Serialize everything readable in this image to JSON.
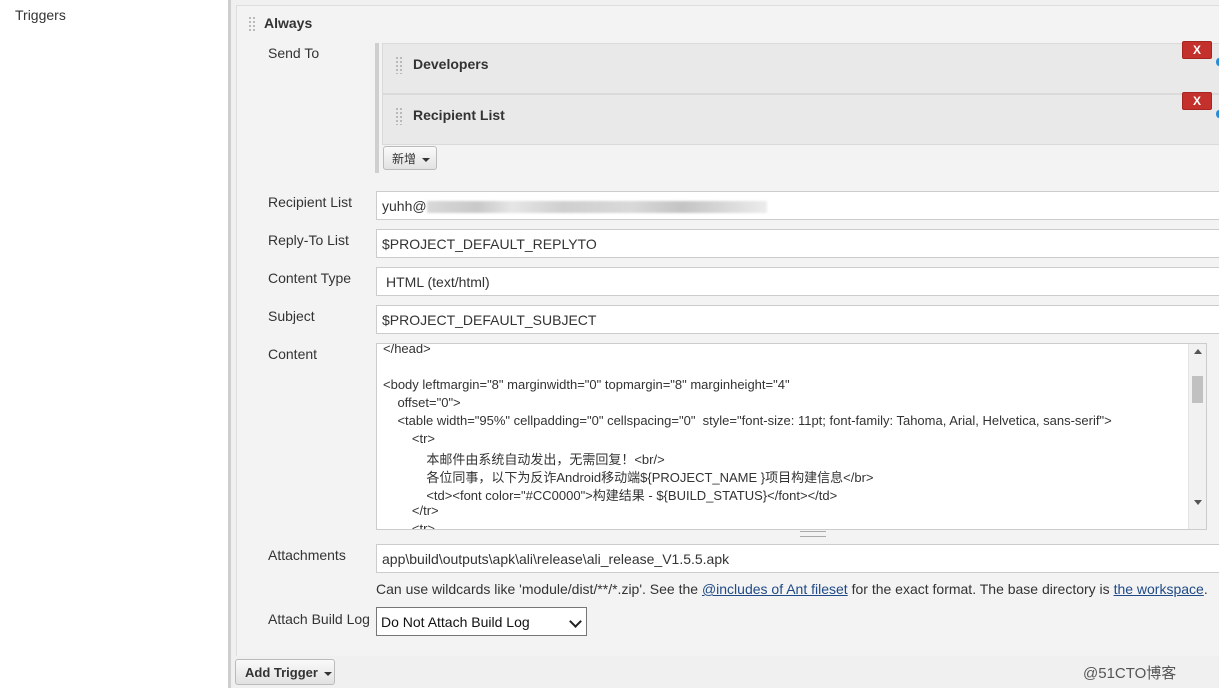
{
  "sidebar": {
    "triggers_label": "Triggers"
  },
  "section": {
    "title": "Always"
  },
  "send_to": {
    "label": "Send To",
    "items": [
      {
        "name": "Developers",
        "remove": "X"
      },
      {
        "name": "Recipient List",
        "remove": "X"
      }
    ],
    "add_button": "新增"
  },
  "fields": {
    "recipient_list": {
      "label": "Recipient List",
      "value_prefix": "yuhh@"
    },
    "reply_to": {
      "label": "Reply-To List",
      "value": "$PROJECT_DEFAULT_REPLYTO"
    },
    "content_type": {
      "label": "Content Type",
      "value": "HTML (text/html)"
    },
    "subject": {
      "label": "Subject",
      "value": "$PROJECT_DEFAULT_SUBJECT"
    },
    "content": {
      "label": "Content",
      "lines": [
        "</head>",
        "",
        "<body leftmargin=\"8\" marginwidth=\"0\" topmargin=\"8\" marginheight=\"4\"",
        "    offset=\"0\">",
        "    <table width=\"95%\" cellpadding=\"0\" cellspacing=\"0\"  style=\"font-size: 11pt; font-family: Tahoma, Arial, Helvetica, sans-serif\">",
        "        <tr>",
        "            本邮件由系统自动发出，无需回复！<br/>",
        "            各位同事，以下为反诈Android移动端${PROJECT_NAME }项目构建信息</br>",
        "            <td><font color=\"#CC0000\">构建结果 - ${BUILD_STATUS}</font></td>",
        "        </tr>",
        "        <tr>"
      ]
    },
    "attachments": {
      "label": "Attachments",
      "value": "app\\build\\outputs\\apk\\ali\\release\\ali_release_V1.5.5.apk"
    },
    "attach_build_log": {
      "label": "Attach Build Log",
      "selected": "Do Not Attach Build Log"
    }
  },
  "help": {
    "text1": "Can use wildcards like 'module/dist/**/*.zip'. See the ",
    "link1": "@includes of Ant fileset",
    "text2": " for the exact format. The base directory is ",
    "link2": "the workspace",
    "text3": "."
  },
  "add_trigger": "Add Trigger",
  "watermark": "@51CTO博客",
  "colors": {
    "remove_button": "#c4302b",
    "link": "#204a87"
  }
}
